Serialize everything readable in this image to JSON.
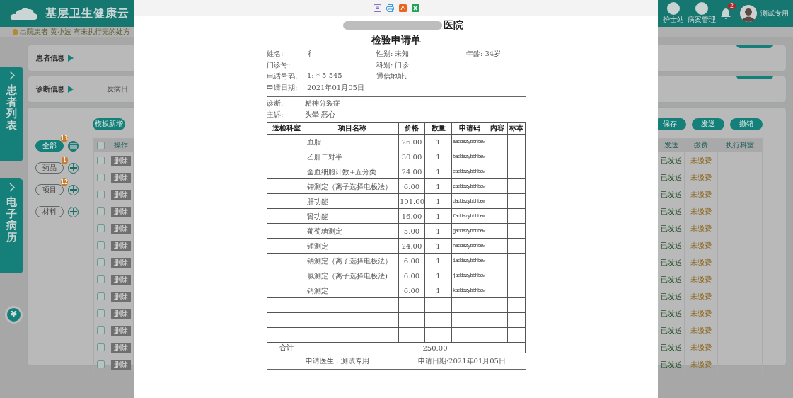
{
  "app": {
    "title": "基层卫生健康云",
    "notice": "出院患者 黄小波 有未执行完的处方",
    "header_actions": [
      {
        "label": "护士站"
      },
      {
        "label": "病案管理"
      }
    ],
    "notifications": "2",
    "user": "测试专用"
  },
  "sidebar": {
    "tabs": [
      {
        "label": "患者列表"
      },
      {
        "label": "电子病历"
      }
    ],
    "currency": "¥"
  },
  "sections": [
    {
      "title": "患者信息"
    },
    {
      "title": "诊断信息",
      "value": "发病日"
    }
  ],
  "filters": [
    {
      "label": "全部",
      "badge": "13",
      "selected": true,
      "kind": "list"
    },
    {
      "label": "药品",
      "badge": "1",
      "selected": false,
      "kind": "add"
    },
    {
      "label": "项目",
      "badge": "12",
      "selected": false,
      "kind": "add"
    },
    {
      "label": "材料",
      "selected": false,
      "kind": "add"
    }
  ],
  "toolbar_buttons": [
    "模板新增",
    "保存",
    "发送",
    "撤销"
  ],
  "orders": {
    "all_checked": false,
    "columns": [
      "操作",
      "发送",
      "缴费",
      "执行科室"
    ],
    "rows": [
      {
        "action": "删除",
        "checked": false,
        "send_status": "已发送",
        "payment": "未缴费"
      },
      {
        "action": "删除",
        "checked": false,
        "send_status": "已发送",
        "payment": "未缴费"
      },
      {
        "action": "删除",
        "checked": false,
        "send_status": "已发送",
        "payment": "未缴费"
      },
      {
        "action": "删除",
        "checked": false,
        "send_status": "已发送",
        "payment": "未缴费"
      },
      {
        "action": "删除",
        "checked": false,
        "send_status": "已发送",
        "payment": "未缴费"
      },
      {
        "action": "删除",
        "checked": false,
        "send_status": "已发送",
        "payment": "未缴费"
      },
      {
        "action": "删除",
        "checked": false,
        "send_status": "已发送",
        "payment": "未缴费"
      },
      {
        "action": "删除",
        "checked": false,
        "send_status": "已发送",
        "payment": "未缴费"
      },
      {
        "action": "删除",
        "checked": false,
        "send_status": "已发送",
        "payment": "未缴费"
      },
      {
        "action": "删除",
        "checked": false,
        "send_status": "已发送",
        "payment": "未缴费"
      },
      {
        "action": "删除",
        "checked": false,
        "send_status": "已发送",
        "payment": "未缴费"
      },
      {
        "action": "删除",
        "checked": false,
        "send_status": "已发送",
        "payment": "未缴费"
      },
      {
        "action": "删除",
        "checked": false,
        "send_status": "已发送",
        "payment": "未缴费"
      }
    ]
  },
  "document": {
    "hospital": "医院",
    "title": "检验申请单",
    "info_rows": [
      [
        {
          "label": "姓名:",
          "value": "彳"
        },
        {
          "label": "性别:",
          "value": "未知"
        },
        {
          "label": "年龄:",
          "value": "34岁"
        }
      ],
      [
        {
          "label": "门诊号:"
        },
        {
          "label": "科别:",
          "value": "门诊"
        }
      ],
      [
        {
          "label": "电话号码:",
          "value": "1: *  5 545"
        },
        {
          "label": "通信地址:"
        }
      ],
      [
        {
          "label": "申请日期:",
          "value": "2021年01月05日"
        }
      ]
    ],
    "clinical": [
      {
        "label": "诊断:",
        "value": "精神分裂症"
      },
      {
        "label": "主诉:",
        "value": "头晕  恶心"
      }
    ],
    "columns": [
      "送检科室",
      "项目名称",
      "价格",
      "数量",
      "申请码",
      "内容",
      "标本"
    ],
    "rows": [
      {
        "kind": "item",
        "item": "血脂",
        "price": "26.00",
        "qty": "1",
        "code": "aaddazybbhbew"
      },
      {
        "kind": "item",
        "item": "乙肝二对半",
        "price": "30.00",
        "qty": "1",
        "code": "baddazybbhbew"
      },
      {
        "kind": "item",
        "item": "全血细胞计数+五分类",
        "price": "24.00",
        "qty": "1",
        "code": "caddazybbhbew"
      },
      {
        "kind": "item",
        "item": "钾测定（离子选择电极法）",
        "price": "6.00",
        "qty": "1",
        "code": "eaddazybbhbew"
      },
      {
        "kind": "item",
        "item": "肝功能",
        "price": "101.00",
        "qty": "1",
        "code": "daddazybbhbew"
      },
      {
        "kind": "item",
        "item": "肾功能",
        "price": "16.00",
        "qty": "1",
        "code": "faddazybbhbew"
      },
      {
        "kind": "item",
        "item": "葡萄糖测定",
        "price": "5.00",
        "qty": "1",
        "code": "gaddazybbhbew"
      },
      {
        "kind": "item",
        "item": "锂测定",
        "price": "24.00",
        "qty": "1",
        "code": "haddazybbhbew"
      },
      {
        "kind": "item",
        "item": "钠测定（离子选择电极法）",
        "price": "6.00",
        "qty": "1",
        "code": "iaddazybbhbew"
      },
      {
        "kind": "item",
        "item": "氯测定（离子选择电极法)",
        "price": "6.00",
        "qty": "1",
        "code": "jaddazybbhbew"
      },
      {
        "kind": "item",
        "item": "钙测定",
        "price": "6.00",
        "qty": "1",
        "code": "kaddazybbhbew"
      },
      {
        "kind": "blank"
      },
      {
        "kind": "blank"
      },
      {
        "kind": "blank"
      }
    ],
    "total_label": "合计",
    "total": "250.00",
    "doctor": "申请医生：测试专用",
    "date": "申请日期:2021年01月05日"
  }
}
